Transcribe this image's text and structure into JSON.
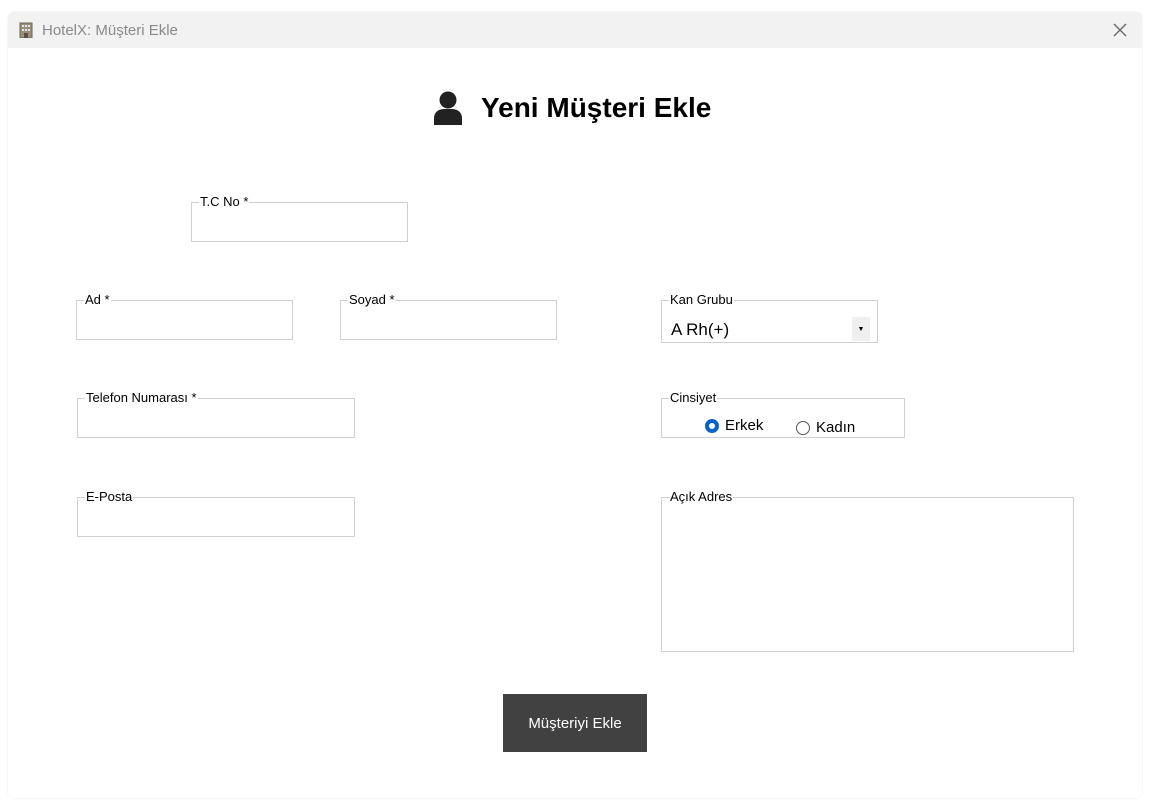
{
  "window": {
    "title": "HotelX: Müşteri Ekle"
  },
  "page": {
    "heading": "Yeni Müşteri Ekle"
  },
  "form": {
    "tc_no": {
      "label": "T.C No *",
      "value": ""
    },
    "ad": {
      "label": "Ad *",
      "value": ""
    },
    "soyad": {
      "label": "Soyad *",
      "value": ""
    },
    "kan_grubu": {
      "label": "Kan Grubu",
      "selected": "A Rh(+)"
    },
    "telefon": {
      "label": "Telefon Numarası *",
      "value": ""
    },
    "cinsiyet": {
      "label": "Cinsiyet",
      "options": [
        {
          "label": "Erkek",
          "selected": true
        },
        {
          "label": "Kadın",
          "selected": false
        }
      ]
    },
    "eposta": {
      "label": "E-Posta",
      "value": ""
    },
    "adres": {
      "label": "Açık Adres",
      "value": ""
    }
  },
  "actions": {
    "submit_label": "Müşteriyi Ekle"
  },
  "colors": {
    "accent": "#0a64c8",
    "button_bg": "#414141",
    "titlebar_bg": "#f2f2f2"
  }
}
